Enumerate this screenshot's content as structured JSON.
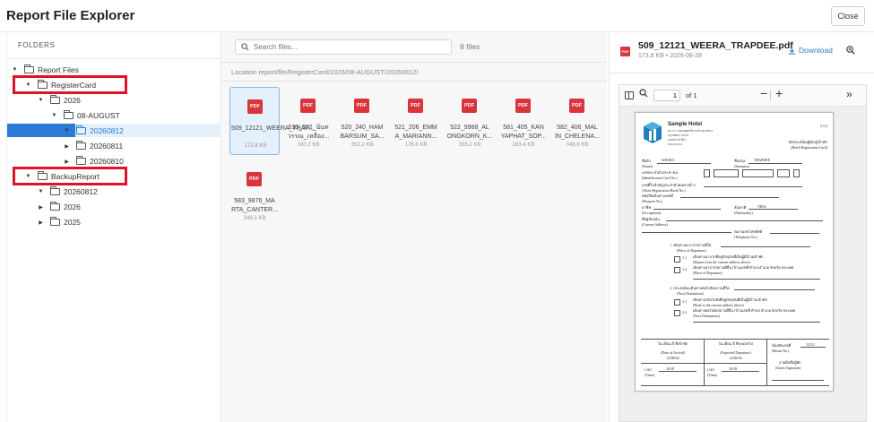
{
  "header": {
    "title": "Report File Explorer",
    "close_label": "Close"
  },
  "sidebar": {
    "title": "FOLDERS",
    "tree": [
      {
        "label": "Report Files",
        "expanded": true
      },
      {
        "label": "RegisterCard",
        "expanded": true,
        "highlighted": true
      },
      {
        "label": "2026",
        "expanded": true
      },
      {
        "label": "08-AUGUST",
        "expanded": true
      },
      {
        "label": "20260812",
        "expanded": true,
        "selected": true
      },
      {
        "label": "20260811",
        "expanded": false
      },
      {
        "label": "20260810",
        "expanded": false
      },
      {
        "label": "BackupReport",
        "expanded": true,
        "highlighted": true
      },
      {
        "label": "20260812",
        "expanded": true
      },
      {
        "label": "2026",
        "expanded": false
      },
      {
        "label": "2025",
        "expanded": false
      }
    ]
  },
  "files": {
    "search_placeholder": "Search files...",
    "count_label": "8 files",
    "path": "Location report/file/RegisterCard/2026/08-AUGUST/20260812/",
    "icon_label": "PDF",
    "items": [
      {
        "name": "509_12121_WEERA_TRAP...",
        "size": "173.8 KB",
        "selected": true
      },
      {
        "name": "510_302_นันท วรรณ_เหลือง...",
        "size": "180.2 KB"
      },
      {
        "name": "520_240_HAM BARSUM_SA...",
        "size": "353.2 KB"
      },
      {
        "name": "521_206_EMM A_MARIANN...",
        "size": "176.6 KB"
      },
      {
        "name": "522_9988_AL ONGKORN_K...",
        "size": "356.2 KB"
      },
      {
        "name": "581_405_KAN YAPHAT_SOP...",
        "size": "183.4 KB"
      },
      {
        "name": "582_406_MAL IN_CHELENA...",
        "size": "348.6 KB"
      },
      {
        "name": "583_9876_MA RTA_CANTER...",
        "size": "348.3 KB"
      }
    ]
  },
  "preview": {
    "icon_label": "PDF",
    "filename": "509_12121_WEERA_TRAPDEE.pdf",
    "meta": "173.8 KB • 2026-08-28",
    "download_label": "Download",
    "toolbar": {
      "page_value": "1",
      "of_label": "of 1"
    },
    "document": {
      "hotel_name": "Sample Hotel",
      "hotel_address": [
        "61/277 ถนนสุขุมวิท 9 ตำบล/แขวง",
        "กรุงเทพฯ 10310",
        "เลขประจำตัว",
        "022222222"
      ],
      "ref_no": "ร.ร.3",
      "form_title_th": "บัตรทะเบียนผู้พัก/ผู้เข้าพัก",
      "form_title_en": "(Hotel Registration Card)",
      "name_label_th": "ชื่อตัว",
      "name_value": "WEERA",
      "name_label_en": "(Name)",
      "surname_label_th": "ชื่อสกุล",
      "surname_value": "TRAPDEE",
      "surname_label_en": "(Surname)",
      "id_label_th": "เลขประจำตัวประชาชน",
      "id_label_en": "(Identification Card No.)",
      "alien_label_th": "เลขที่ใบสำคัญประจำตัวคนต่างด้าว",
      "alien_label_en": "(Alien Registration Book No.)",
      "passport_label_th": "หนังสือเดินทางเลขที่",
      "passport_label_en": "(Passport No.)",
      "occupation_label_th": "อาชีพ",
      "occupation_label_en": "(Occupation)",
      "nationality_label_th": "สัญชาติ",
      "nationality_value": "THAI",
      "nationality_label_en": "(Nationality)",
      "current_addr_label_th": "ที่อยู่ปัจจุบัน",
      "current_addr_label_en": "(Current Address)",
      "tel_label_th": "หมายเลขโทรศัพท์",
      "tel_label_en": "(Telephone No.)",
      "departure_title_th": "1.  เดินทางมาจากสถานที่ใด",
      "departure_title_en": "(Place of Departure)",
      "dep_1_1_th": "เดินทางมาจากที่อยู่ปัจจุบันที่เป็นผู้มีบ้านเข้าพัก",
      "dep_1_1_en": "(Depart from the current address above)",
      "dep_1_2_th": "เดินทางมาจากสถานที่อื่น (บ้านเลขที่ ตำบล อำเภอ จังหวัด ประเทศ",
      "dep_1_2_en": "(Place of Departure)",
      "next_title_th": "2.  ประสงค์จะเดินทางต่อไปยังสถานที่ใด",
      "next_title_en": "(Next Destination)",
      "next_2_1_th": "เดินทางกลับไปยังที่อยู่ปัจจุบันที่เป็นผู้มีบ้านเข้าพัก",
      "next_2_1_en": "(Back to the current address above)",
      "next_2_2_th": "เดินทางต่อไปยังสถานที่อื่น (บ้านเลขที่ ตำบล อำเภอ จังหวัด ประเทศ",
      "next_2_2_en": "(Next Destination)",
      "arrival_label_th": "วัน เดือน ปี ที่เข้าพัก",
      "arrival_label_en": "(Date of Arrival)",
      "arrival_date": "12/08/26",
      "expected_label_th": "วัน เดือน ปี ที่จะออกไป",
      "expected_label_en": "(Expected Departure)",
      "expected_date": "12/08/26",
      "room_label_th": "ห้องพักเลขที่",
      "room_value": "12121",
      "room_label_en": "(Room No.)",
      "guest_sig_th": "ลายมือชื่อผู้พัก",
      "guest_sig_en": "(Guest Signature)",
      "time_label_th": "เวลา",
      "time_label_en": "(Time)",
      "arrival_time": "10:39",
      "expected_time": "10:39"
    }
  },
  "colors": {
    "accent": "#2a7bd4",
    "highlight_box": "#e0112b",
    "pdf_red": "#d9353a",
    "selected_bg": "#e4f0fb"
  }
}
